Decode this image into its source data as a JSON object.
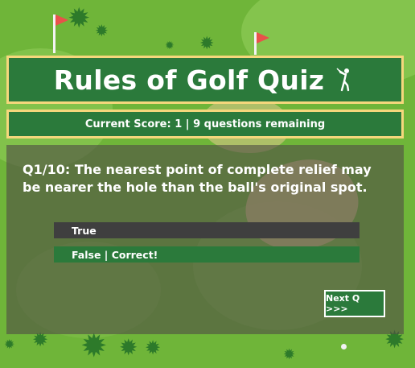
{
  "quiz": {
    "title": "Rules of Golf Quiz",
    "title_icon": "golfer-icon",
    "score_text": "Current Score: 1 | 9 questions remaining",
    "question": "Q1/10: The nearest point of complete relief may be nearer the hole than the ball's original spot.",
    "answers": [
      {
        "label": "True"
      },
      {
        "label": "False | Correct!"
      }
    ],
    "next_label": "Next Q >>>"
  },
  "colors": {
    "grass": "#6fb539",
    "panel_green": "#2b7a3b",
    "border_gold": "#f5d77c",
    "flag_red": "#e8524a",
    "answer_dark": "#3f3f3f"
  }
}
